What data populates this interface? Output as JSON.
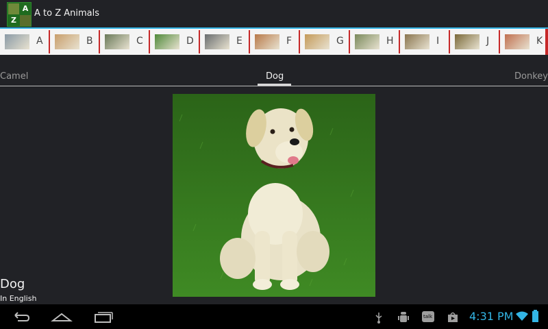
{
  "app": {
    "title": "A to Z Animals",
    "icon_letters": [
      "A",
      "Z"
    ]
  },
  "letter_strip": {
    "items": [
      {
        "letter": "A",
        "thumb_color": "#8a9aa6"
      },
      {
        "letter": "B",
        "thumb_color": "#c89e6c"
      },
      {
        "letter": "C",
        "thumb_color": "#6a7a5a"
      },
      {
        "letter": "D",
        "thumb_color": "#4f8a3a"
      },
      {
        "letter": "E",
        "thumb_color": "#6a6e70"
      },
      {
        "letter": "F",
        "thumb_color": "#b87a4a"
      },
      {
        "letter": "G",
        "thumb_color": "#c49a5a"
      },
      {
        "letter": "H",
        "thumb_color": "#7a8a5c"
      },
      {
        "letter": "I",
        "thumb_color": "#8a7650"
      },
      {
        "letter": "J",
        "thumb_color": "#7b6a3a"
      },
      {
        "letter": "K",
        "thumb_color": "#c07050"
      }
    ]
  },
  "pager": {
    "previous": "Camel",
    "current": "Dog",
    "next": "Donkey"
  },
  "animal": {
    "name": "Dog",
    "language": "In English"
  },
  "status_bar": {
    "time": "4:31 PM",
    "talk_label": "talk"
  },
  "colors": {
    "accent": "#33b5e5",
    "separator": "#c62828",
    "background": "#212226"
  },
  "icons": [
    "back-icon",
    "home-icon",
    "recent-apps-icon",
    "usb-icon",
    "android-debug-icon",
    "talk-icon",
    "play-store-icon",
    "wifi-icon",
    "battery-icon"
  ]
}
